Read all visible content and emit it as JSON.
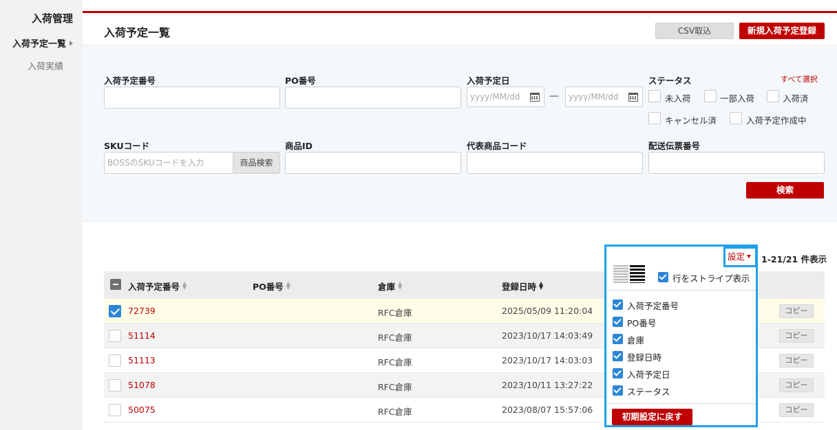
{
  "sidebar": {
    "title": "入荷管理",
    "items": [
      {
        "label": "入荷予定一覧",
        "active": true
      },
      {
        "label": "入荷実績",
        "active": false
      }
    ]
  },
  "header": {
    "title": "入荷予定一覧",
    "csv_label": "CSV取込",
    "new_label": "新規入荷予定登録"
  },
  "filter": {
    "receipt_no_label": "入荷予定番号",
    "po_label": "PO番号",
    "date_label": "入荷予定日",
    "date_from_placeholder": "yyyy/MM/dd",
    "date_to_placeholder": "yyyy/MM/dd",
    "date_separator": "—",
    "status_label": "ステータス",
    "select_all": "すべて選択",
    "statuses": [
      "未入荷",
      "一部入荷",
      "入荷済",
      "キャンセル済",
      "入荷予定作成中"
    ],
    "sku_label": "SKUコード",
    "sku_placeholder": "BOSSのSKUコードを入力",
    "product_search": "商品検索",
    "product_id_label": "商品ID",
    "rep_code_label": "代表商品コード",
    "tracking_label": "配送伝票番号",
    "search_label": "検索"
  },
  "table": {
    "count": "1-21/21 件表示",
    "columns": [
      "入荷予定番号",
      "PO番号",
      "倉庫",
      "登録日時"
    ],
    "copy_label": "コピー",
    "rows": [
      {
        "id": "72739",
        "po": "",
        "warehouse": "RFC倉庫",
        "datetime": "2025/05/09 11:20:04",
        "checked": true
      },
      {
        "id": "51114",
        "po": "",
        "warehouse": "RFC倉庫",
        "datetime": "2023/10/17 14:03:49",
        "checked": false
      },
      {
        "id": "51113",
        "po": "",
        "warehouse": "RFC倉庫",
        "datetime": "2023/10/17 14:03:03",
        "checked": false
      },
      {
        "id": "51078",
        "po": "",
        "warehouse": "RFC倉庫",
        "datetime": "2023/10/11 13:27:22",
        "checked": false
      },
      {
        "id": "50075",
        "po": "",
        "warehouse": "RFC倉庫",
        "datetime": "2023/08/07 15:57:06",
        "checked": false
      }
    ]
  },
  "settings": {
    "label": "設定",
    "stripe_label": "行をストライプ表示",
    "columns": [
      "入荷予定番号",
      "PO番号",
      "倉庫",
      "登録日時",
      "入荷予定日",
      "ステータス"
    ],
    "reset_label": "初期設定に戻す"
  }
}
